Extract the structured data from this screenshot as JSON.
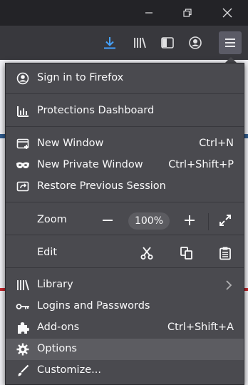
{
  "window_controls": {
    "minimize_icon": "minimize-icon",
    "restore_icon": "restore-icon",
    "close_icon": "close-icon"
  },
  "toolbar": {
    "icons": [
      "download-icon",
      "library-icon",
      "sidebar-icon",
      "account-icon",
      "hamburger-menu-icon"
    ],
    "accent": "#45a1ff"
  },
  "menu": {
    "sign_in": "Sign in to Firefox",
    "protections": "Protections Dashboard",
    "new_window": {
      "label": "New Window",
      "shortcut": "Ctrl+N"
    },
    "new_private_window": {
      "label": "New Private Window",
      "shortcut": "Ctrl+Shift+P"
    },
    "restore_session": "Restore Previous Session",
    "zoom": {
      "label": "Zoom",
      "value": "100%"
    },
    "edit": {
      "label": "Edit"
    },
    "library": "Library",
    "logins": "Logins and Passwords",
    "addons": {
      "label": "Add-ons",
      "shortcut": "Ctrl+Shift+A"
    },
    "options": "Options",
    "customize": "Customize..."
  }
}
